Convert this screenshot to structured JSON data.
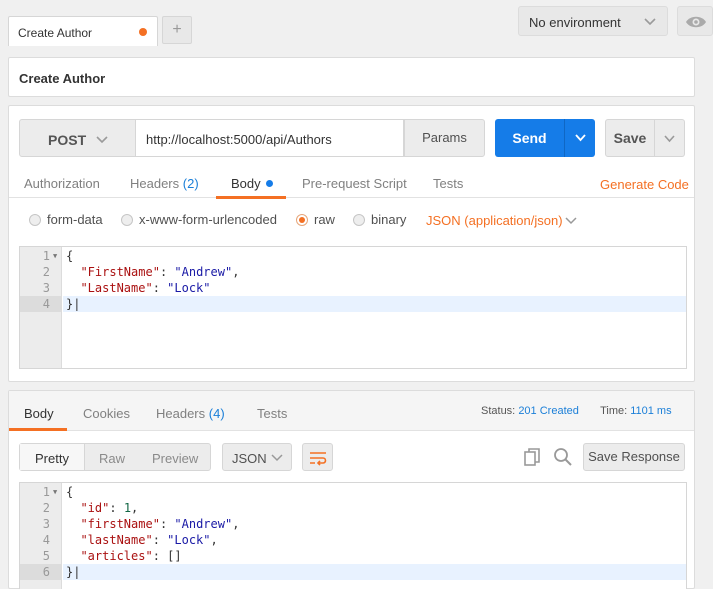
{
  "tab": {
    "label": "Create Author",
    "add_label": "+"
  },
  "environment": {
    "label": "No environment"
  },
  "request": {
    "name": "Create Author",
    "method": "POST",
    "url": "http://localhost:5000/api/Authors",
    "params_label": "Params",
    "send_label": "Send",
    "save_label": "Save",
    "tabs": [
      {
        "label": "Authorization"
      },
      {
        "label": "Headers",
        "count": "(2)"
      },
      {
        "label": "Body"
      },
      {
        "label": "Pre-request Script"
      },
      {
        "label": "Tests"
      }
    ],
    "generate_code_label": "Generate Code",
    "body_modes": [
      "form-data",
      "x-www-form-urlencoded",
      "raw",
      "binary"
    ],
    "selected_body_mode": "raw",
    "content_type": "JSON (application/json)",
    "body_lines": {
      "l1": "{",
      "l2_key": "\"FirstName\"",
      "l2_val": "\"Andrew\"",
      "l3_key": "\"LastName\"",
      "l3_val": "\"Lock\"",
      "l4": "}"
    },
    "line_numbers": [
      "1",
      "2",
      "3",
      "4"
    ]
  },
  "response": {
    "tabs": [
      {
        "label": "Body"
      },
      {
        "label": "Cookies"
      },
      {
        "label": "Headers",
        "count": "(4)"
      },
      {
        "label": "Tests"
      }
    ],
    "status_label": "Status:",
    "status_value": "201 Created",
    "time_label": "Time:",
    "time_value": "1101 ms",
    "view_modes": [
      "Pretty",
      "Raw",
      "Preview"
    ],
    "format": "JSON",
    "save_response_label": "Save Response",
    "line_numbers": [
      "1",
      "2",
      "3",
      "4",
      "5",
      "6"
    ],
    "body_lines": {
      "l1": "{",
      "l2_key": "\"id\"",
      "l2_val": "1",
      "l3_key": "\"firstName\"",
      "l3_val": "\"Andrew\"",
      "l4_key": "\"lastName\"",
      "l4_val": "\"Lock\"",
      "l5_key": "\"articles\"",
      "l5_val": "[]",
      "l6": "}"
    }
  },
  "colors": {
    "accent": "#f47023",
    "primary": "#157ce8",
    "link": "#1b7fd8"
  }
}
